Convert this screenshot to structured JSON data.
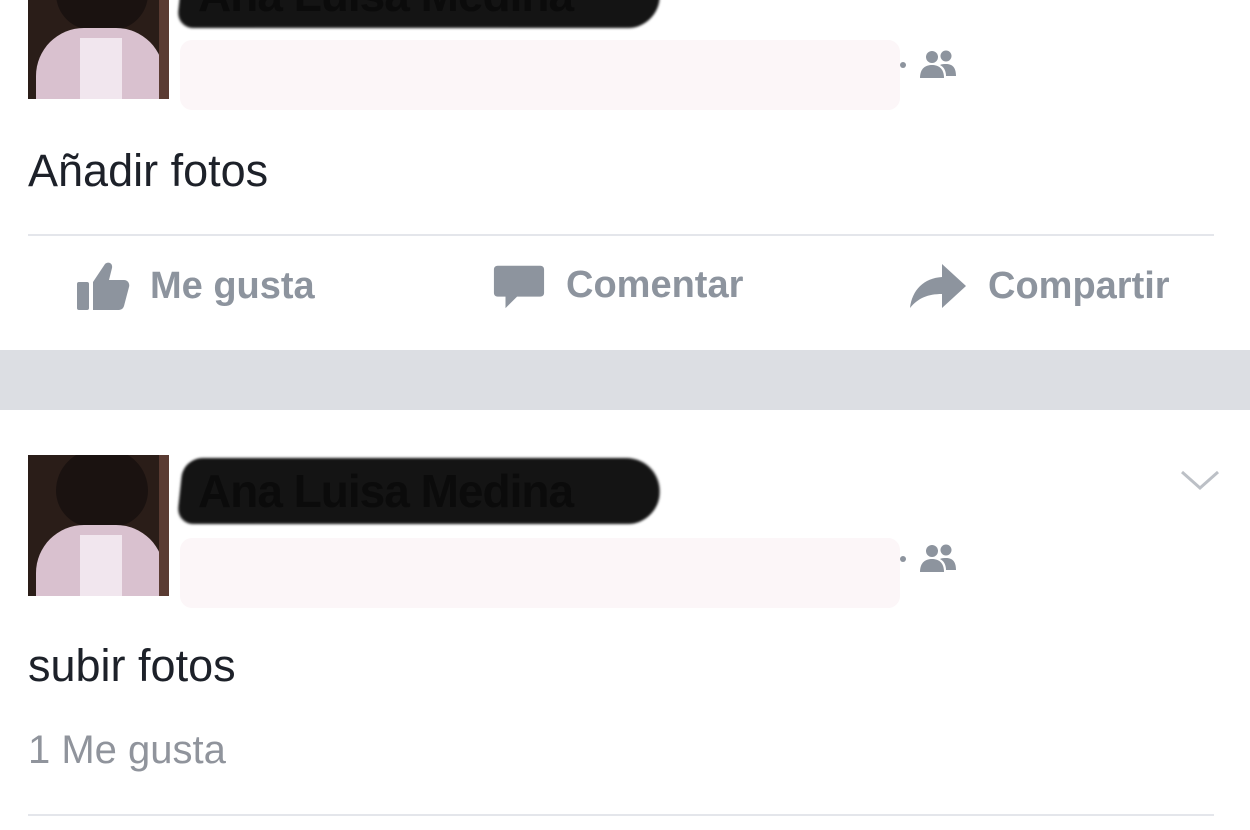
{
  "posts": [
    {
      "author": "Ana Luisa Medina",
      "audience_icon": "friends-icon",
      "text": "Añadir fotos",
      "actions": {
        "like": "Me gusta",
        "comment": "Comentar",
        "share": "Compartir"
      }
    },
    {
      "author": "Ana Luisa Medina",
      "audience_icon": "friends-icon",
      "text": "subir fotos",
      "likes": "1 Me gusta",
      "menu_icon": "chevron-down-icon"
    }
  ],
  "colors": {
    "separator": "#dcdee3",
    "muted": "#8d949e",
    "text": "#1d2129"
  }
}
